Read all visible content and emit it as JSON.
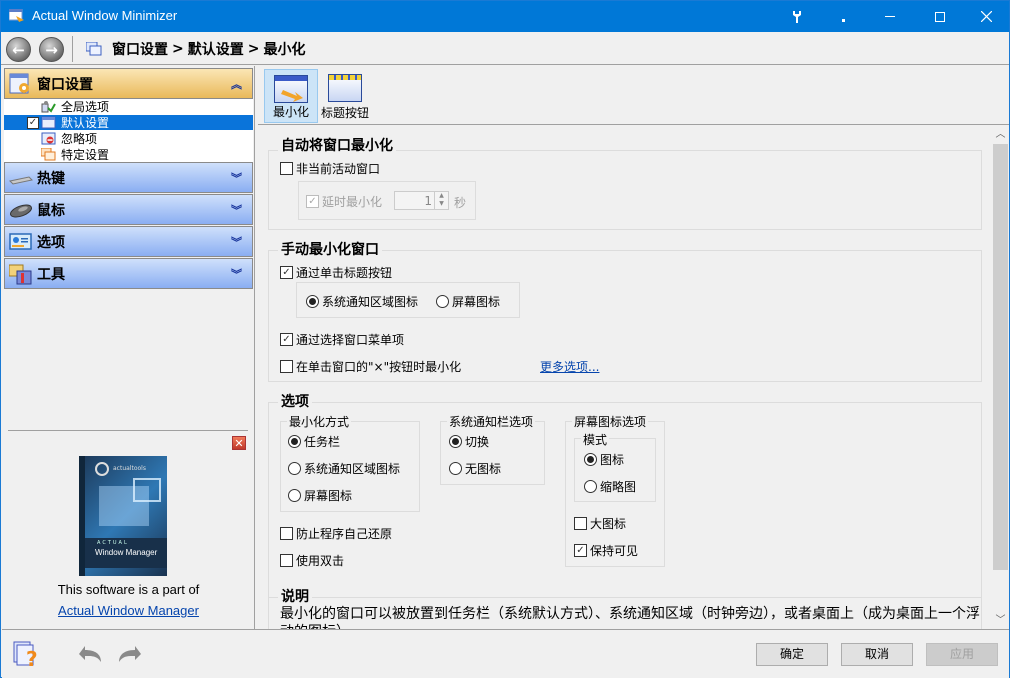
{
  "window": {
    "title": "Actual Window Minimizer",
    "controls": {
      "pin": "🔧",
      "minimize_small": "·",
      "minimize": "—",
      "maximize": "☐",
      "close": "✕"
    }
  },
  "nav": {
    "back_icon": "arrow-left",
    "forward_icon": "arrow-right",
    "breadcrumb": [
      "窗口设置",
      ">",
      "默认设置",
      ">",
      "最小化"
    ]
  },
  "sidebar": {
    "groups": [
      {
        "label": "窗口设置",
        "expanded": true,
        "chevron": "︽",
        "items": [
          {
            "label": "全局选项",
            "selected": false
          },
          {
            "label": "默认设置",
            "selected": true,
            "checked": true
          },
          {
            "label": "忽略项",
            "selected": false
          },
          {
            "label": "特定设置",
            "selected": false
          }
        ]
      },
      {
        "label": "热键",
        "expanded": false,
        "chevron": "︾"
      },
      {
        "label": "鼠标",
        "expanded": false,
        "chevron": "︾"
      },
      {
        "label": "选项",
        "expanded": false,
        "chevron": "︾"
      },
      {
        "label": "工具",
        "expanded": false,
        "chevron": "︾"
      }
    ],
    "promo": {
      "close": "✕",
      "box_brand": "actualtools",
      "box_line1": "ACTUAL",
      "box_line2": "Window Manager",
      "text": "This software is a part of",
      "link": "Actual Window Manager"
    }
  },
  "toolstrip": {
    "tabs": [
      {
        "label": "最小化",
        "selected": true
      },
      {
        "label": "标题按钮",
        "selected": false
      }
    ]
  },
  "sections": {
    "auto": {
      "title": "自动将窗口最小化",
      "inactive_window": {
        "label": "非当前活动窗口",
        "checked": false
      },
      "delay": {
        "label": "延时最小化",
        "checked": true,
        "disabled": true,
        "value": "1",
        "unit": "秒"
      }
    },
    "manual": {
      "title": "手动最小化窗口",
      "title_button": {
        "label": "通过单击标题按钮",
        "checked": true
      },
      "radio_tray": {
        "label": "系统通知区域图标",
        "selected": true
      },
      "radio_screen": {
        "label": "屏幕图标",
        "selected": false
      },
      "window_menu": {
        "label": "通过选择窗口菜单项",
        "checked": true
      },
      "close_button": {
        "label": "在单击窗口的\"×\"按钮时最小化",
        "checked": false
      },
      "more_options": "更多选项..."
    },
    "options": {
      "title": "选项",
      "method": {
        "title": "最小化方式",
        "items": [
          {
            "label": "任务栏",
            "selected": true
          },
          {
            "label": "系统通知区域图标",
            "selected": false
          },
          {
            "label": "屏幕图标",
            "selected": false
          }
        ]
      },
      "tray": {
        "title": "系统通知栏选项",
        "items": [
          {
            "label": "切换",
            "selected": true
          },
          {
            "label": "无图标",
            "selected": false
          }
        ]
      },
      "screen": {
        "title": "屏幕图标选项",
        "mode_title": "模式",
        "mode_items": [
          {
            "label": "图标",
            "selected": true
          },
          {
            "label": "缩略图",
            "selected": false
          }
        ],
        "large_icons": {
          "label": "大图标",
          "checked": false
        },
        "keep_visible": {
          "label": "保持可见",
          "checked": true
        }
      },
      "prevent_restore": {
        "label": "防止程序自己还原",
        "checked": false
      },
      "double_click": {
        "label": "使用双击",
        "checked": false
      }
    },
    "description": {
      "title": "说明",
      "text": "最小化的窗口可以被放置到任务栏（系统默认方式）、系统通知区域（时钟旁边），或者桌面上（成为桌面上一个浮动的图标）。"
    }
  },
  "footer": {
    "ok": "确定",
    "cancel": "取消",
    "apply": "应用"
  }
}
